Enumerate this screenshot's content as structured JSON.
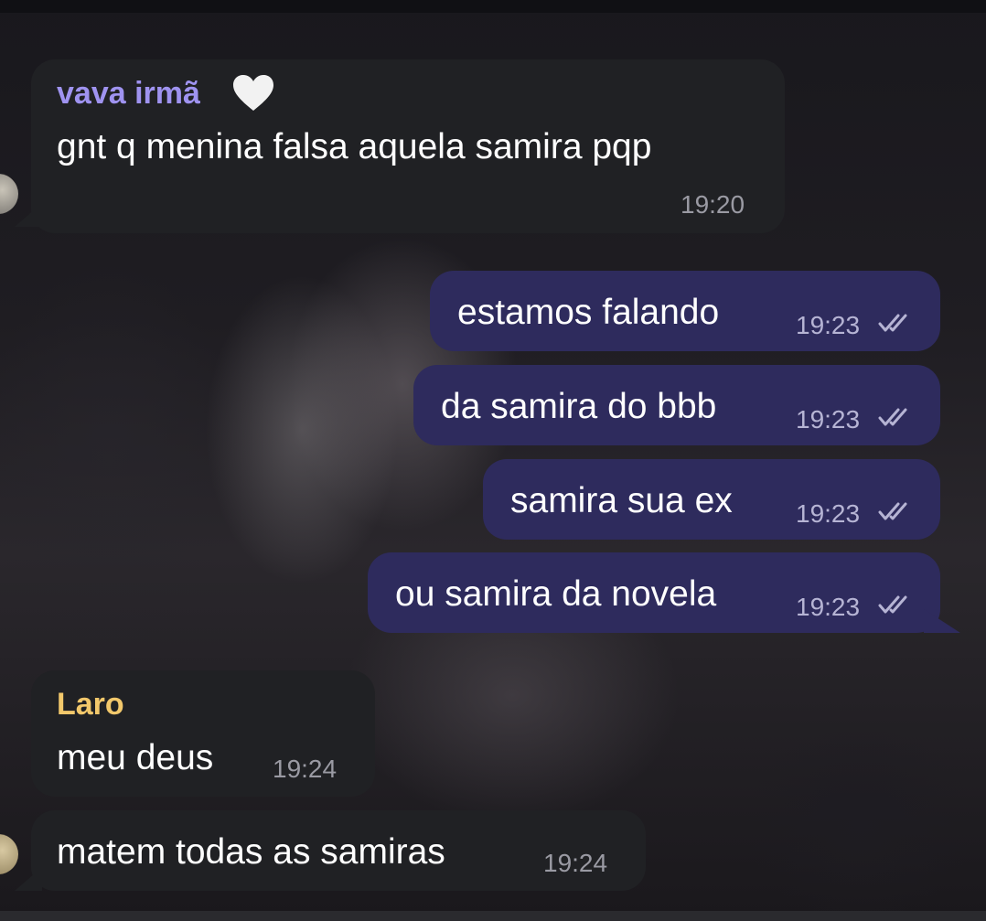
{
  "chat": {
    "messages": [
      {
        "sender": "vava irmã",
        "text": "gnt q menina falsa aquela samira pqp",
        "time": "19:20",
        "emoji": "white-heart-icon"
      },
      {
        "text": "estamos falando",
        "time": "19:23"
      },
      {
        "text": "da samira do bbb",
        "time": "19:23"
      },
      {
        "text": "samira sua ex",
        "time": "19:23"
      },
      {
        "text": "ou samira da novela",
        "time": "19:23"
      },
      {
        "sender": "Laro",
        "text": "meu deus",
        "time": "19:24"
      },
      {
        "text": "matem todas as samiras",
        "time": "19:24"
      }
    ]
  },
  "colors": {
    "incoming_bubble": "#202124",
    "outgoing_bubble": "#2e2b5d",
    "sender_vava": "#9f93f0",
    "sender_laro": "#f2c86b",
    "timestamp": "#9a9aa3",
    "read_checks": "#b6b4d4"
  }
}
